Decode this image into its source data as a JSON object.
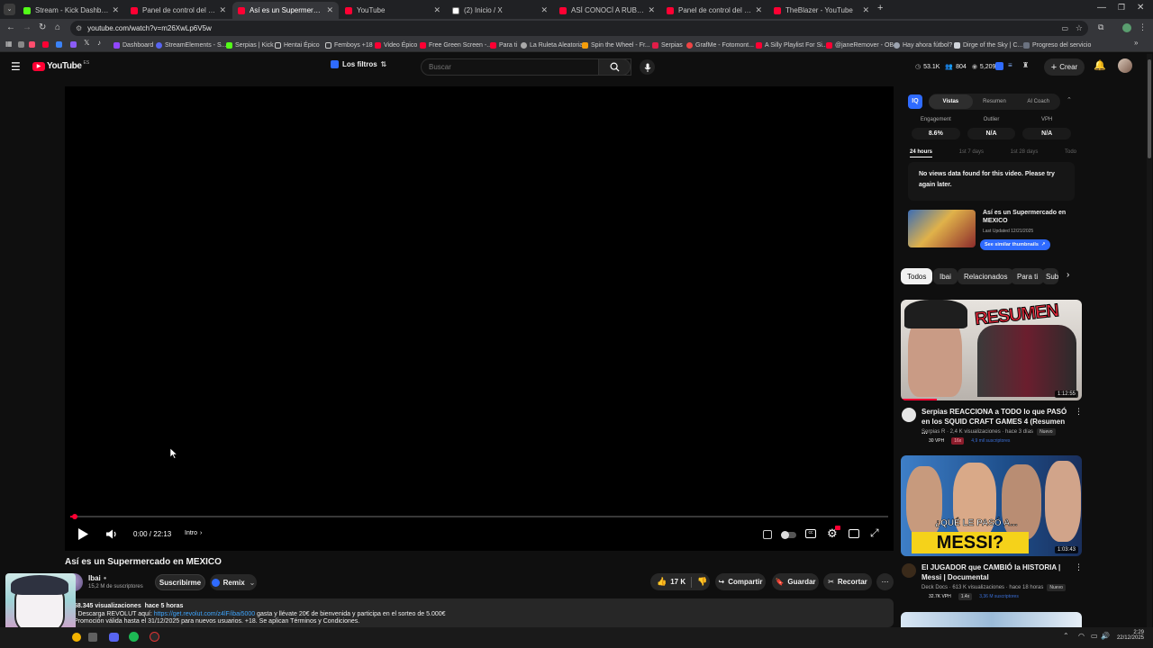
{
  "tabs": [
    {
      "title": "Stream - Kick Dashboard",
      "color": "#53fc18"
    },
    {
      "title": "Panel de control del canal - Yo",
      "color": "#ff0033"
    },
    {
      "title": "Así es un Supermercado en ME",
      "color": "#ff0033"
    },
    {
      "title": "YouTube",
      "color": "#ff0033"
    },
    {
      "title": "(2) Inicio / X",
      "color": "#ffffff"
    },
    {
      "title": "ASÍ CONOCÍ A RUBIUS Y AURO",
      "color": "#ff0033"
    },
    {
      "title": "Panel de control del canal - Yo",
      "color": "#ff0033"
    },
    {
      "title": "TheBlazer - YouTube",
      "color": "#ff0033"
    }
  ],
  "address": {
    "url": "youtube.com/watch?v=m26XwLp6V5w"
  },
  "bookmarks": [
    "Dashboard",
    "StreamElements - S...",
    "Serpias | Kick",
    "Hentai Épico",
    "Femboys +18",
    "Video Épico",
    "Free Green Screen -...",
    "Para ti",
    "La Ruleta Aleatoria",
    "Spin the Wheel - Fr...",
    "Serpias",
    "GrafMe - Fotomont...",
    "A Silly Playlist For Si...",
    "@janeRemover - OB...",
    "Hay ahora fútbol?",
    "Dirge of the Sky | C...",
    "Progreso del servicio"
  ],
  "masthead": {
    "logo": "YouTube",
    "country": "ES",
    "filters_label": "Los filtros",
    "search_placeholder": "Buscar",
    "stats": [
      "53.1K",
      "804",
      "5,209"
    ],
    "create_label": "Crear"
  },
  "player": {
    "time": "0:00 / 22:13",
    "chapter": "Intro",
    "progress": 0.005
  },
  "video": {
    "title": "Así es un Supermercado en MEXICO",
    "channel": "Ibai",
    "subscribers": "15,2 M de suscriptores",
    "subscribe_label": "Suscribirme",
    "remix_label": "Remix",
    "likes": "17 K",
    "share_label": "Compartir",
    "save_label": "Guardar",
    "clip_label": "Recortar",
    "views_line": "58.345 visualizaciones  hace 5 horas",
    "desc_line1_prefix": "Descarga REVOLUT aquí: ",
    "desc_link": "https://get.revolut.com/z4lF/ibai5000",
    "desc_line1_suffix": " gasta y llévate 20€ de bienvenida y participa en el sorteo de 5.000€",
    "desc_line2": "Promoción válida hasta el 31/12/2025 para nuevos usuarios. +18. Se aplican Términos y Condiciones."
  },
  "vidiq": {
    "tabs": [
      "Vistas",
      "Resumen",
      "AI Coach"
    ],
    "metrics": [
      {
        "label": "Engagement",
        "value": "8.6%"
      },
      {
        "label": "Outlier",
        "value": "N/A"
      },
      {
        "label": "VPH",
        "value": "N/A"
      }
    ],
    "ranges": [
      "24 hours",
      "1st 7 days",
      "1st 28 days",
      "Todo"
    ],
    "no_data": "No views data found for this video. Please try again later.",
    "thumb_title": "Así es un Supermercado en MEXICO",
    "last_updated": "Last Updated 12/21/2025",
    "similar_label": "See similar thumbnails"
  },
  "chips": [
    "Todos",
    "Ibai",
    "Relacionados",
    "Para ti",
    "Sub"
  ],
  "recommendations": [
    {
      "title": "Serpias REACCIONA a TODO lo que PASÓ en los SQUID CRAFT GAMES 4 (Resumen ...",
      "meta": "Serpias R · 2,4 K visualizaciones · hace 3 días",
      "badge": "Nuevo",
      "vph": "30 VPH",
      "mult": "16x",
      "subs": "4,9 mil suscriptores",
      "duration": "1:12:55",
      "thumb_text": "RESUMEN"
    },
    {
      "title": "El JUGADOR que CAMBIÓ la HISTORIA | Messi | Documental",
      "meta": "Deck Docs · 613 K visualizaciones · hace 18 horas",
      "badge": "Nuevo",
      "vph": "32.7K VPH",
      "mult": "1.4x",
      "subs": "3,36 M suscriptores",
      "duration": "1:03:43",
      "thumb_text_top": "¿QUÉ LE PASÓ A...",
      "thumb_text": "MESSI?"
    }
  ],
  "clock": {
    "time": "2:29",
    "date": "22/12/2025"
  },
  "colors": {
    "youtube_red": "#ff0033",
    "vidiq_blue": "#2f6bff",
    "bg": "#0f0f0f"
  }
}
